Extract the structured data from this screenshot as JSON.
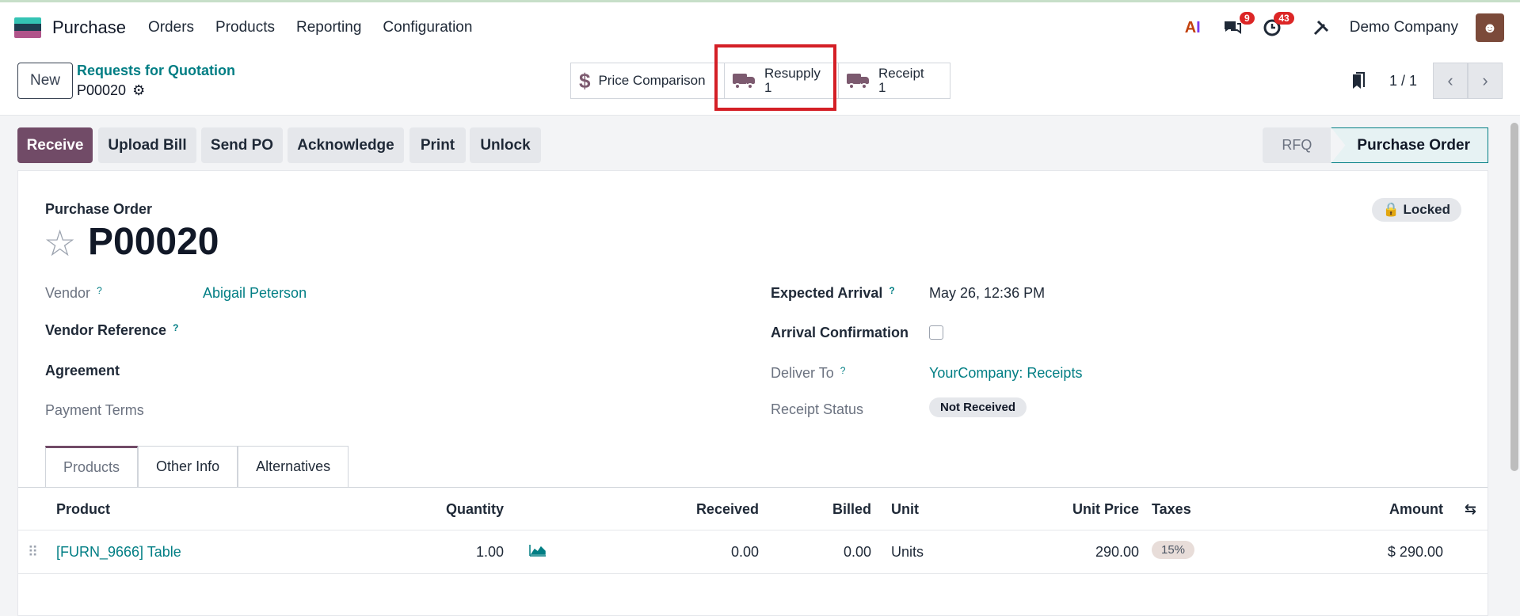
{
  "app": {
    "name": "Purchase",
    "menu": [
      "Orders",
      "Products",
      "Reporting",
      "Configuration"
    ],
    "brand_colors": [
      "#34c3b4",
      "#1d3d4f",
      "#b0548a"
    ],
    "notifications": {
      "messages": "9",
      "activities": "43"
    },
    "company": "Demo Company"
  },
  "control": {
    "new_label": "New",
    "breadcrumb_parent": "Requests for Quotation",
    "breadcrumb_current": "P00020",
    "smart_buttons": [
      {
        "label": "Price Comparison",
        "icon": "dollar-icon"
      },
      {
        "label": "Resupply",
        "count": "1",
        "icon": "truck-icon"
      },
      {
        "label": "Receipt",
        "count": "1",
        "icon": "truck-icon"
      }
    ],
    "pager": "1 / 1"
  },
  "actions": {
    "buttons": [
      "Receive",
      "Upload Bill",
      "Send PO",
      "Acknowledge",
      "Print",
      "Unlock"
    ],
    "status": [
      "RFQ",
      "Purchase Order"
    ]
  },
  "form": {
    "title_label": "Purchase Order",
    "name": "P00020",
    "locked": "Locked",
    "vendor_label": "Vendor",
    "vendor_value": "Abigail Peterson",
    "vendor_ref_label": "Vendor Reference",
    "agreement_label": "Agreement",
    "payment_terms_label": "Payment Terms",
    "expected_arrival_label": "Expected Arrival",
    "expected_arrival_value": "May 26, 12:36 PM",
    "arrival_confirmation_label": "Arrival Confirmation",
    "deliver_to_label": "Deliver To",
    "deliver_to_value": "YourCompany: Receipts",
    "receipt_status_label": "Receipt Status",
    "receipt_status_value": "Not Received",
    "help_mark": "?"
  },
  "tabs": [
    "Products",
    "Other Info",
    "Alternatives"
  ],
  "table": {
    "headers": [
      "Product",
      "Quantity",
      "Received",
      "Billed",
      "Unit",
      "Unit Price",
      "Taxes",
      "Amount"
    ],
    "rows": [
      {
        "product": "[FURN_9666] Table",
        "quantity": "1.00",
        "received": "0.00",
        "billed": "0.00",
        "unit": "Units",
        "unit_price": "290.00",
        "taxes": "15%",
        "amount": "$ 290.00"
      }
    ]
  }
}
